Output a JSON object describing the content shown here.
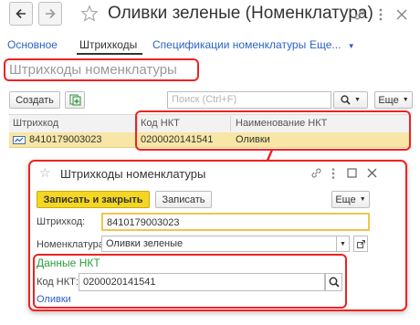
{
  "window": {
    "title": "Оливки зеленые (Номенклатура)",
    "nav": [
      "back-arrow",
      "forward-arrow"
    ],
    "icons": [
      "star-icon",
      "link-icon",
      "more-vertical-icon",
      "close-icon"
    ]
  },
  "tabs": [
    {
      "label": "Основное",
      "active": false
    },
    {
      "label": "Штрихкоды",
      "active": true
    },
    {
      "label": "Спецификации номенклатуры",
      "active": false
    },
    {
      "label": "Еще...",
      "active": false
    }
  ],
  "section_title": "Штрихкоды номенклатуры",
  "list_toolbar": {
    "create_label": "Создать",
    "search_placeholder": "Поиск (Ctrl+F)",
    "more_label": "Еще"
  },
  "table": {
    "columns": [
      "Штрихкод",
      "Код НКТ",
      "Наименование НКТ"
    ],
    "rows": [
      {
        "barcode": "8410179003023",
        "code": "0200020141541",
        "name": "Оливки",
        "selected": true
      }
    ]
  },
  "dialog": {
    "title": "Штрихкоды номенклатуры",
    "save_close_label": "Записать и закрыть",
    "save_label": "Записать",
    "more_label": "Еще",
    "barcode_label": "Штрихкод:",
    "barcode_value": "8410179003023",
    "nomenclature_label": "Номенклатура:",
    "nomenclature_value": "Оливки зеленые",
    "nkt_group_title": "Данные НКТ",
    "nkt_code_label": "Код НКТ:",
    "nkt_code_value": "0200020141541",
    "nkt_name_link": "Оливки"
  },
  "colors": {
    "accent_yellow": "#f4d623",
    "highlight_red": "#ee2222",
    "link_blue": "#2b63c4",
    "green_text": "#2a9d3a",
    "selected_row": "#f7e6a6"
  }
}
